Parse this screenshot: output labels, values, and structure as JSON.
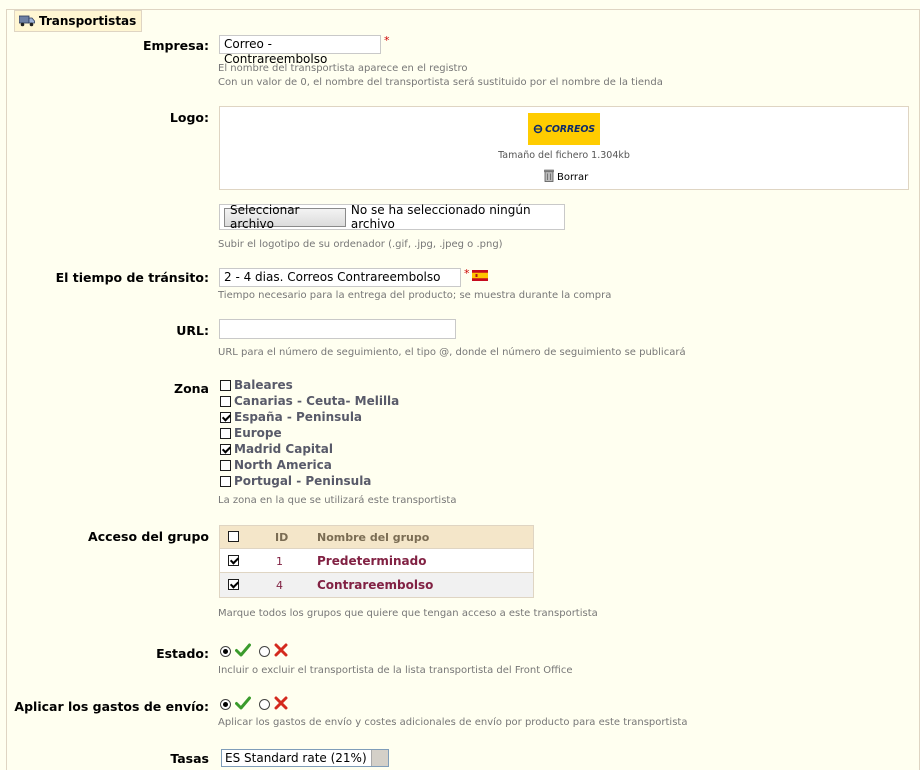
{
  "section": {
    "title": "Transportistas",
    "icon": "truck-icon"
  },
  "empresa": {
    "label": "Empresa:",
    "value": "Correo - Contrareembolso",
    "required": "*",
    "hint1": "El nombre del transportista aparece en el registro",
    "hint2": "Con un valor de 0, el nombre del transportista será sustituido por el nombre de la tienda"
  },
  "logo": {
    "label": "Logo:",
    "image_text": "CORREOS",
    "file_size": "Tamaño del fichero 1.304kb",
    "delete_label": "Borrar",
    "file_button": "Seleccionar archivo",
    "file_status": "No se ha seleccionado ningún archivo",
    "hint": "Subir el logotipo de su ordenador (.gif, .jpg, .jpeg o .png)"
  },
  "transit": {
    "label": "El tiempo de tránsito:",
    "value": "2 - 4 dias. Correos Contrareembolso",
    "required": "*",
    "flag": "spain-flag-icon",
    "hint": "Tiempo necesario para la entrega del producto; se muestra durante la compra"
  },
  "url": {
    "label": "URL:",
    "value": "",
    "hint": "URL para el número de seguimiento, el tipo @, donde el número de seguimiento se publicará"
  },
  "zona": {
    "label": "Zona",
    "items": [
      {
        "label": "Baleares",
        "checked": false
      },
      {
        "label": "Canarias - Ceuta- Melilla",
        "checked": false
      },
      {
        "label": "España - Peninsula",
        "checked": true
      },
      {
        "label": "Europe",
        "checked": false
      },
      {
        "label": "Madrid Capital",
        "checked": true
      },
      {
        "label": "North America",
        "checked": false
      },
      {
        "label": "Portugal - Peninsula",
        "checked": false
      }
    ],
    "hint": "La zona en la que se utilizará este transportista"
  },
  "grupo": {
    "label": "Acceso del grupo",
    "col_id": "ID",
    "col_name": "Nombre del grupo",
    "rows": [
      {
        "id": "1",
        "name": "Predeterminado",
        "checked": true
      },
      {
        "id": "4",
        "name": "Contrareembolso",
        "checked": true
      }
    ],
    "hint": "Marque todos los grupos que quiere que tengan acceso a este transportista"
  },
  "estado": {
    "label": "Estado:",
    "value": "enabled",
    "hint": "Incluir o excluir el transportista de la lista transportista del Front Office"
  },
  "gastos": {
    "label": "Aplicar los gastos de envío:",
    "value": "enabled",
    "hint": "Aplicar los gastos de envío y costes adicionales de envío por producto para este transportista"
  },
  "tasas": {
    "label": "Tasas",
    "selected": "ES Standard rate (21%)"
  }
}
